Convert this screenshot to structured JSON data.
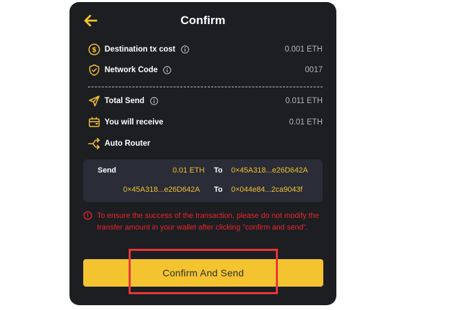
{
  "header": {
    "title": "Confirm",
    "back_icon": "arrow-left-icon"
  },
  "details": {
    "dest_tx_cost": {
      "label": "Destination tx cost",
      "value": "0.001 ETH",
      "icon": "dollar-coin-icon"
    },
    "network_code": {
      "label": "Network Code",
      "value": "0017",
      "icon": "shield-check-icon"
    },
    "total_send": {
      "label": "Total Send",
      "value": "0.011 ETH",
      "icon": "send-icon"
    },
    "you_receive": {
      "label": "You will receive",
      "value": "0.01 ETH",
      "icon": "wallet-icon"
    },
    "auto_router": {
      "label": "Auto Router",
      "icon": "route-icon"
    }
  },
  "route": {
    "row1": {
      "label": "Send",
      "amount": "0.01 ETH",
      "to": "To",
      "address": "0×45A318...e26D642A"
    },
    "row2": {
      "from_address": "0×45A318...e26D642A",
      "to": "To",
      "address": "0×044e84...2ca9043f"
    }
  },
  "warning": {
    "text": "To ensure the success of the transaction, please do not modify the transfer amount in your wallet after clicking \"confirm and send\"."
  },
  "action": {
    "confirm_label": "Confirm And Send"
  },
  "colors": {
    "accent": "#f4c430",
    "panel": "#1d1e22",
    "route_box": "#2a2c37",
    "warning": "#e8262c",
    "highlight": "#e8363a"
  }
}
